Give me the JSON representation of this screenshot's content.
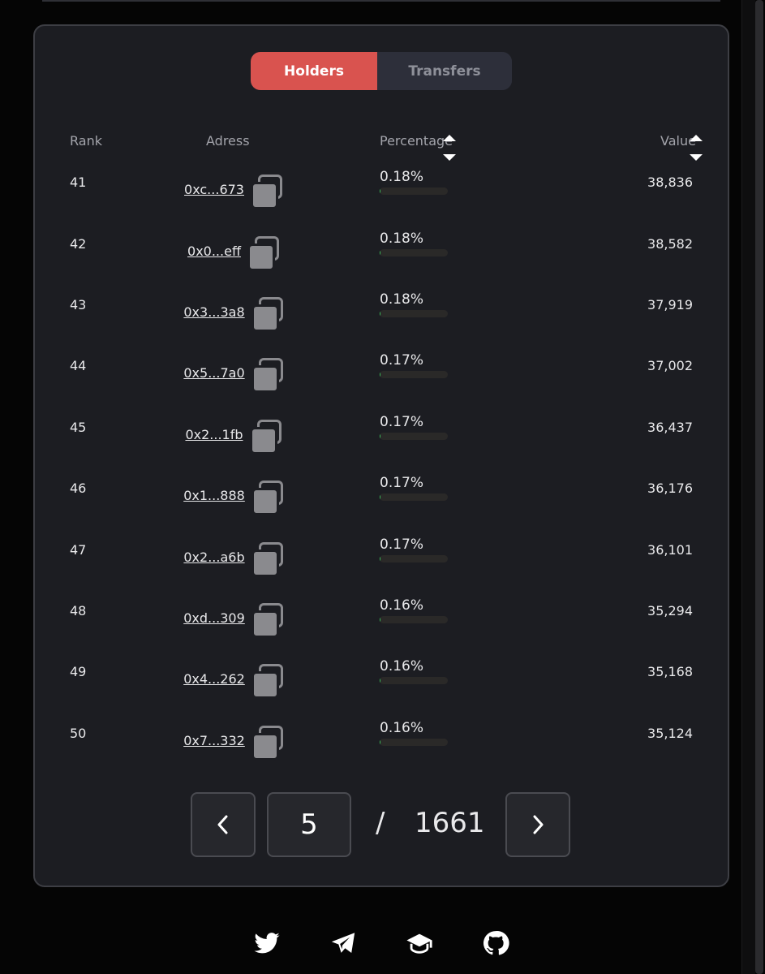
{
  "tabs": [
    {
      "label": "Holders",
      "active": true
    },
    {
      "label": "Transfers",
      "active": false
    }
  ],
  "table": {
    "headers": {
      "rank": "Rank",
      "address": "Adress",
      "percentage": "Percentage",
      "value": "Value"
    },
    "rows": [
      {
        "rank": "41",
        "address": "0xc...673",
        "percentage": "0.18%",
        "pct_fraction": 0.0018,
        "value": "38,836"
      },
      {
        "rank": "42",
        "address": "0x0...eff",
        "percentage": "0.18%",
        "pct_fraction": 0.0018,
        "value": "38,582"
      },
      {
        "rank": "43",
        "address": "0x3...3a8",
        "percentage": "0.18%",
        "pct_fraction": 0.0018,
        "value": "37,919"
      },
      {
        "rank": "44",
        "address": "0x5...7a0",
        "percentage": "0.17%",
        "pct_fraction": 0.0017,
        "value": "37,002"
      },
      {
        "rank": "45",
        "address": "0x2...1fb",
        "percentage": "0.17%",
        "pct_fraction": 0.0017,
        "value": "36,437"
      },
      {
        "rank": "46",
        "address": "0x1...888",
        "percentage": "0.17%",
        "pct_fraction": 0.0017,
        "value": "36,176"
      },
      {
        "rank": "47",
        "address": "0x2...a6b",
        "percentage": "0.17%",
        "pct_fraction": 0.0017,
        "value": "36,101"
      },
      {
        "rank": "48",
        "address": "0xd...309",
        "percentage": "0.16%",
        "pct_fraction": 0.0016,
        "value": "35,294"
      },
      {
        "rank": "49",
        "address": "0x4...262",
        "percentage": "0.16%",
        "pct_fraction": 0.0016,
        "value": "35,168"
      },
      {
        "rank": "50",
        "address": "0x7...332",
        "percentage": "0.16%",
        "pct_fraction": 0.0016,
        "value": "35,124"
      }
    ]
  },
  "pagination": {
    "current_page": "5",
    "separator": "/",
    "total_pages": "1661"
  },
  "footer": {
    "social_icons": [
      "twitter-icon",
      "telegram-icon",
      "docs-icon",
      "github-icon"
    ]
  },
  "colors": {
    "accent": "#d9534f",
    "panel": "#1c1d22",
    "background": "#050505",
    "bar_fill": "#3bbf5a"
  }
}
